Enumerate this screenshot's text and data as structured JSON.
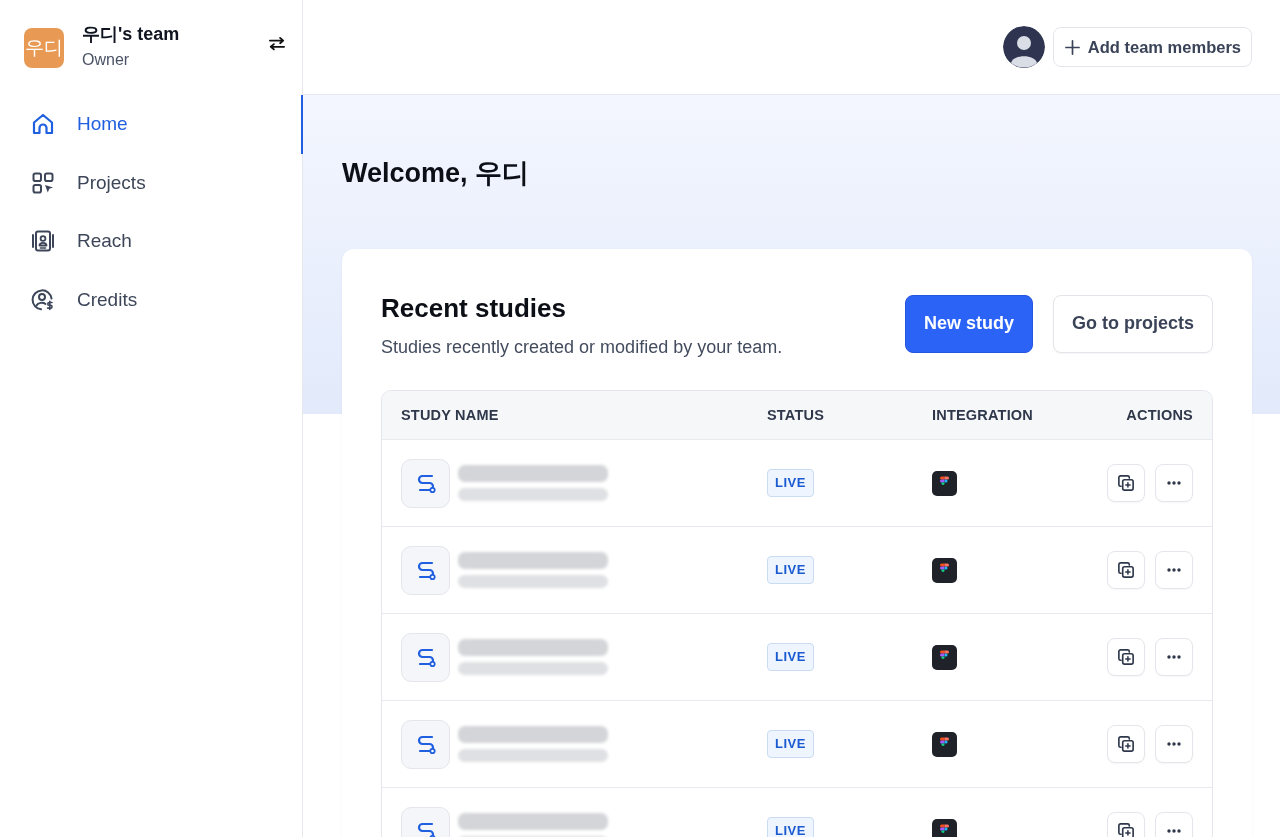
{
  "team": {
    "logo": "우디",
    "name": "우디's team",
    "role": "Owner"
  },
  "nav": [
    {
      "label": "Home",
      "selected": true
    },
    {
      "label": "Projects",
      "selected": false
    },
    {
      "label": "Reach",
      "selected": false
    },
    {
      "label": "Credits",
      "selected": false
    }
  ],
  "header": {
    "add_members_button": "Add team members"
  },
  "welcome": {
    "title": "Welcome, 우디"
  },
  "recent_studies": {
    "title": "Recent studies",
    "subtitle": "Studies recently created or modified by your team.",
    "buttons": [
      {
        "label": "New study",
        "kind": "primary"
      },
      {
        "label": "Go to projects",
        "kind": "secondary"
      }
    ]
  },
  "table": {
    "columns": [
      "STUDY NAME",
      "STATUS",
      "INTEGRATION",
      "ACTIONS"
    ],
    "rows": [
      {
        "status": "LIVE"
      },
      {
        "status": "LIVE"
      },
      {
        "status": "LIVE"
      },
      {
        "status": "LIVE"
      },
      {
        "status": "LIVE"
      }
    ]
  }
}
